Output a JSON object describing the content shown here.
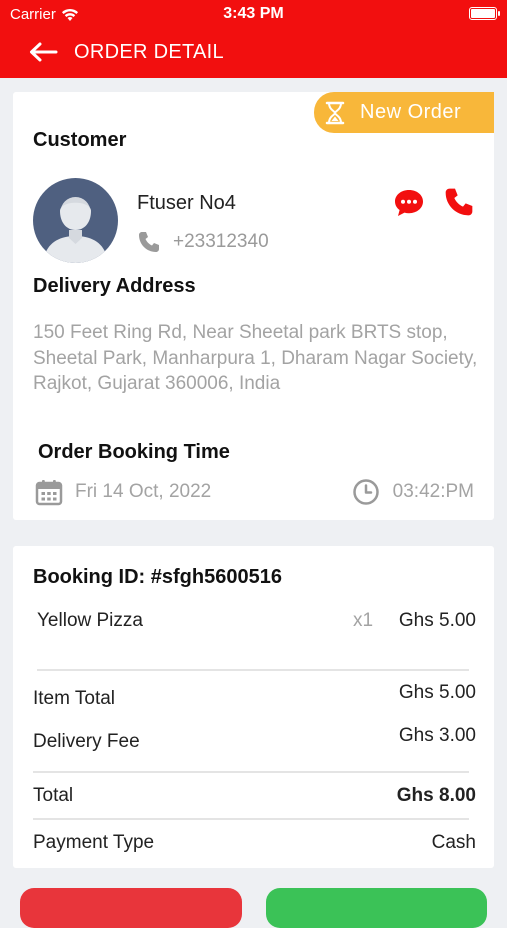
{
  "status_bar": {
    "carrier": "Carrier",
    "time": "3:43 PM"
  },
  "header": {
    "title": "ORDER DETAIL"
  },
  "order": {
    "status_badge": "New Order",
    "customer_label": "Customer",
    "customer_name": "Ftuser No4",
    "customer_phone": "+23312340",
    "delivery_address_label": "Delivery Address",
    "delivery_address": "150 Feet Ring Rd, Near Sheetal park BRTS stop, Sheetal Park, Manharpura 1, Dharam Nagar Society, Rajkot, Gujarat 360006, India",
    "booking_time_label": "Order Booking Time",
    "booking_date": "Fri 14 Oct, 2022",
    "booking_time": "03:42:PM"
  },
  "summary": {
    "booking_id": "Booking ID: #sfgh5600516",
    "items": [
      {
        "name": "Yellow Pizza",
        "qty": "x1",
        "price": "Ghs 5.00"
      }
    ],
    "item_total_label": "Item Total",
    "item_total_value": "Ghs 5.00",
    "delivery_fee_label": "Delivery Fee",
    "delivery_fee_value": "Ghs 3.00",
    "total_label": "Total",
    "total_value": "Ghs 8.00",
    "payment_type_label": "Payment Type",
    "payment_type_value": "Cash"
  },
  "colors": {
    "brand_red": "#f20f0f",
    "badge_orange": "#f8b73a",
    "button_red": "#e8353b",
    "button_green": "#3bc257"
  },
  "icons": [
    "wifi-icon",
    "battery-icon",
    "back-arrow-icon",
    "hourglass-icon",
    "chat-icon",
    "phone-call-icon",
    "phone-icon",
    "calendar-icon",
    "clock-icon"
  ]
}
